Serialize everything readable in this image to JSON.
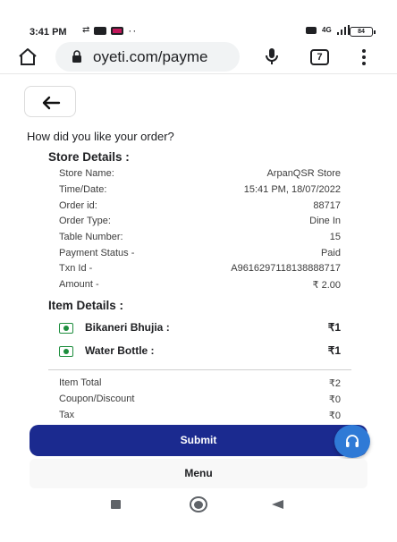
{
  "status_bar": {
    "time": "3:41 PM",
    "left_dots": "··",
    "network_label": "4G",
    "battery": "84"
  },
  "browser": {
    "url": "oyeti.com/payme",
    "tab_count": "7"
  },
  "page": {
    "question": "How did you like your order?",
    "store_details_title": "Store Details :",
    "store_details": [
      {
        "label": "Store Name:",
        "value": "ArpanQSR Store"
      },
      {
        "label": "Time/Date:",
        "value": "15:41 PM, 18/07/2022"
      },
      {
        "label": "Order id:",
        "value": "88717"
      },
      {
        "label": "Order Type:",
        "value": "Dine In"
      },
      {
        "label": "Table Number:",
        "value": "15"
      },
      {
        "label": "Payment Status -",
        "value": "Paid"
      },
      {
        "label": "Txn Id -",
        "value": "A9616297118138888717"
      },
      {
        "label": "Amount -",
        "value": "₹ 2.00"
      }
    ],
    "item_details_title": "Item Details :",
    "items": [
      {
        "name": "Bikaneri Bhujia :",
        "price": "₹1"
      },
      {
        "name": "Water Bottle :",
        "price": "₹1"
      }
    ],
    "summary": [
      {
        "label": "Item Total",
        "value": "₹2"
      },
      {
        "label": "Coupon/Discount",
        "value": "₹0"
      },
      {
        "label": "Tax",
        "value": "₹0"
      }
    ],
    "submit_label": "Submit",
    "menu_label": "Menu"
  },
  "colors": {
    "submit_bg": "#1b2a8f",
    "support_fab": "#2f7ad6",
    "veg_green": "#1e8e3e"
  },
  "icons": [
    "home-icon",
    "lock-icon",
    "mic-icon",
    "tabs-icon",
    "more-vert-icon",
    "back-arrow-icon",
    "veg-icon",
    "headset-icon",
    "nav-recent-icon",
    "nav-home-icon",
    "nav-back-icon"
  ]
}
